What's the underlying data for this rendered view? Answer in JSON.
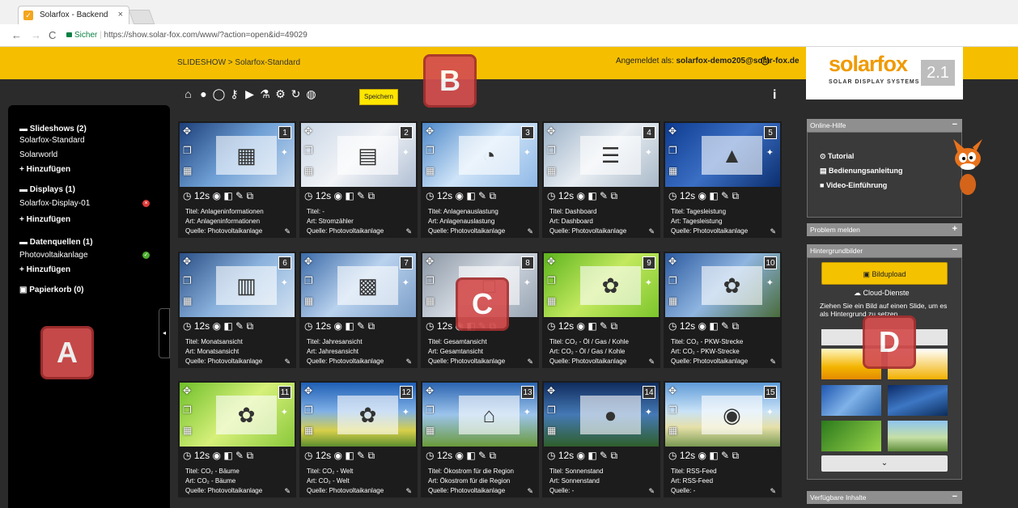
{
  "browser": {
    "tab_title": "Solarfox - Backend",
    "secure_label": "Sicher",
    "url": "https://show.solar-fox.com/www/?action=open&id=49029"
  },
  "header": {
    "breadcrumb": "SLIDESHOW > Solarfox-Standard",
    "login_prefix": "Angemeldet als:",
    "login_user": "solarfox-demo205@solar-fox.de"
  },
  "logo": {
    "text": "solarfox",
    "sub": "SOLAR DISPLAY SYSTEMS",
    "version": "2.1"
  },
  "toolbar": {
    "save_label": "Speichern",
    "icons": [
      "home-icon",
      "user-icon",
      "chat-icon",
      "key-icon",
      "play-icon",
      "flask-icon",
      "gears-icon",
      "refresh-icon",
      "globe-icon"
    ]
  },
  "sidebar": {
    "slideshows_header": "Slideshows (2)",
    "slideshows": [
      "Solarfox-Standard",
      "Solarworld"
    ],
    "add1": "Hinzufügen",
    "displays_header": "Displays (1)",
    "displays": [
      "Solarfox-Display-01"
    ],
    "add2": "Hinzufügen",
    "sources_header": "Datenquellen (1)",
    "sources": [
      "Photovoltaikanlage"
    ],
    "add3": "Hinzufügen",
    "trash": "Papierkorb (0)"
  },
  "slides": [
    {
      "num": "1",
      "duration": "12s",
      "title": "Titel: Anlageninformationen",
      "art": "Art: Anlageninformationen",
      "source": "Quelle: Photovoltaikanlage"
    },
    {
      "num": "2",
      "duration": "12s",
      "title": "Titel: -",
      "art": "Art: Stromzähler",
      "source": "Quelle: Photovoltaikanlage"
    },
    {
      "num": "3",
      "duration": "12s",
      "title": "Titel: Anlagenauslastung",
      "art": "Art: Anlagenauslastung",
      "source": "Quelle: Photovoltaikanlage"
    },
    {
      "num": "4",
      "duration": "12s",
      "title": "Titel: Dashboard",
      "art": "Art: Dashboard",
      "source": "Quelle: Photovoltaikanlage"
    },
    {
      "num": "5",
      "duration": "12s",
      "title": "Titel: Tagesleistung",
      "art": "Art: Tagesleistung",
      "source": "Quelle: Photovoltaikanlage"
    },
    {
      "num": "6",
      "duration": "12s",
      "title": "Titel: Monatsansicht",
      "art": "Art: Monatsansicht",
      "source": "Quelle: Photovoltaikanlage"
    },
    {
      "num": "7",
      "duration": "12s",
      "title": "Titel: Jahresansicht",
      "art": "Art: Jahresansicht",
      "source": "Quelle: Photovoltaikanlage"
    },
    {
      "num": "8",
      "duration": "12s",
      "title": "Titel: Gesamtansicht",
      "art": "Art: Gesamtansicht",
      "source": "Quelle: Photovoltaikanlage"
    },
    {
      "num": "9",
      "duration": "12s",
      "title": "Titel: CO₂ - Öl / Gas / Kohle",
      "art": "Art: CO₂ - Öl / Gas / Kohle",
      "source": "Quelle: Photovoltaikanlage"
    },
    {
      "num": "10",
      "duration": "12s",
      "title": "Titel: CO₂ - PKW-Strecke",
      "art": "Art: CO₂ - PKW-Strecke",
      "source": "Quelle: Photovoltaikanlage"
    },
    {
      "num": "11",
      "duration": "12s",
      "title": "Titel: CO₂ - Bäume",
      "art": "Art: CO₂ - Bäume",
      "source": "Quelle: Photovoltaikanlage"
    },
    {
      "num": "12",
      "duration": "12s",
      "title": "Titel: CO₂ - Welt",
      "art": "Art: CO₂ - Welt",
      "source": "Quelle: Photovoltaikanlage"
    },
    {
      "num": "13",
      "duration": "12s",
      "title": "Titel: Ökostrom für die Region",
      "art": "Art: Ökostrom für die Region",
      "source": "Quelle: Photovoltaikanlage"
    },
    {
      "num": "14",
      "duration": "12s",
      "title": "Titel: Sonnenstand",
      "art": "Art: Sonnenstand",
      "source": "Quelle: -"
    },
    {
      "num": "15",
      "duration": "12s",
      "title": "Titel: RSS-Feed",
      "art": "Art: RSS-Feed",
      "source": "Quelle: -"
    }
  ],
  "right": {
    "online_help": "Online-Hilfe",
    "tutorial": "Tutorial",
    "manual": "Bedienungsanleitung",
    "video": "Video-Einführung",
    "problem": "Problem melden",
    "backgrounds": "Hintergrundbilder",
    "upload": "Bildupload",
    "cloud": "Cloud-Dienste",
    "hint": "Ziehen Sie ein Bild auf einen Slide, um es als Hintergrund zu setzen.",
    "available": "Verfügbare Inhalte"
  },
  "markers": [
    "A",
    "B",
    "C",
    "D"
  ]
}
